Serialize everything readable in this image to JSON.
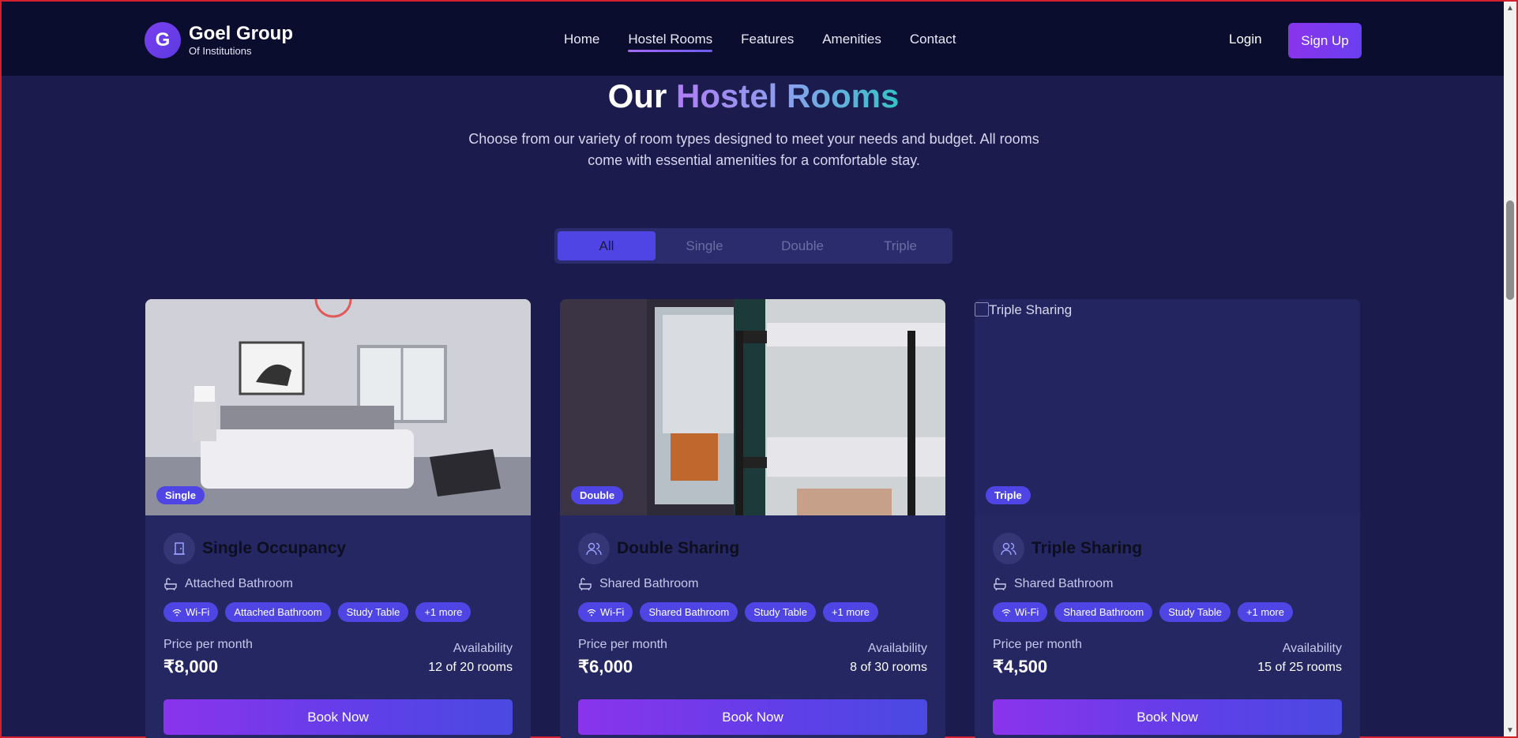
{
  "header": {
    "logo_letter": "G",
    "brand_name": "Goel Group",
    "brand_sub": "Of Institutions",
    "nav": [
      "Home",
      "Hostel Rooms",
      "Features",
      "Amenities",
      "Contact"
    ],
    "active_nav": "Hostel Rooms",
    "login_label": "Login",
    "signup_label": "Sign Up"
  },
  "hero": {
    "title_part1": "Our",
    "title_part2": "Hostel Rooms",
    "subtitle": "Choose from our variety of room types designed to meet your needs and budget. All rooms come with essential amenities for a comfortable stay."
  },
  "filters": {
    "tabs": [
      "All",
      "Single",
      "Double",
      "Triple"
    ],
    "active": "All"
  },
  "rooms": [
    {
      "badge": "Single",
      "title": "Single Occupancy",
      "icon": "door-icon",
      "bathroom": "Attached Bathroom",
      "chips": [
        "Wi-Fi",
        "Attached Bathroom",
        "Study Table",
        "+1 more"
      ],
      "price_label": "Price per month",
      "price": "₹8,000",
      "availability_label": "Availability",
      "availability": "12 of 20 rooms",
      "book_label": "Book Now",
      "image_alt": ""
    },
    {
      "badge": "Double",
      "title": "Double Sharing",
      "icon": "users-icon",
      "bathroom": "Shared Bathroom",
      "chips": [
        "Wi-Fi",
        "Shared Bathroom",
        "Study Table",
        "+1 more"
      ],
      "price_label": "Price per month",
      "price": "₹6,000",
      "availability_label": "Availability",
      "availability": "8 of 30 rooms",
      "book_label": "Book Now",
      "image_alt": ""
    },
    {
      "badge": "Triple",
      "title": "Triple Sharing",
      "icon": "users-icon",
      "bathroom": "Shared Bathroom",
      "chips": [
        "Wi-Fi",
        "Shared Bathroom",
        "Study Table",
        "+1 more"
      ],
      "price_label": "Price per month",
      "price": "₹4,500",
      "availability_label": "Availability",
      "availability": "15 of 25 rooms",
      "book_label": "Book Now",
      "image_alt": "Triple Sharing"
    }
  ],
  "colors": {
    "accent": "#4f45e4",
    "brand_purple": "#8a34ec",
    "background": "#1b1c4d",
    "header_bg": "#0b0d2e",
    "card_bg": "#252762"
  }
}
